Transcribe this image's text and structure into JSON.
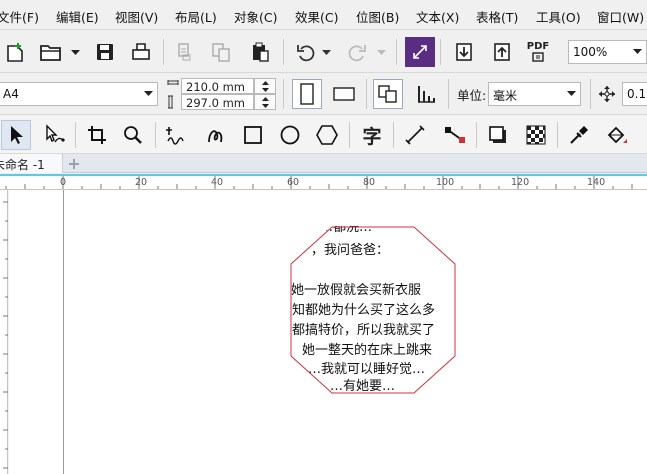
{
  "menu": [
    "文件(F)",
    "编辑(E)",
    "视图(V)",
    "布局(L)",
    "对象(C)",
    "效果(C)",
    "位图(B)",
    "文本(X)",
    "表格(T)",
    "工具(O)",
    "窗口(W)"
  ],
  "toolbar": {
    "pdf_label": "PDF",
    "zoom_value": "100%"
  },
  "property_bar": {
    "page_size": "A4",
    "width": "210.0 mm",
    "height": "297.0 mm",
    "units_label": "单位:",
    "units_value": "毫米",
    "nudge_value": "0.1"
  },
  "tools": {
    "text_tool_glyph": "字"
  },
  "tab": {
    "document_name": "未命名 -1"
  },
  "ruler": {
    "marks": [
      "0",
      "20",
      "40",
      "60",
      "80",
      "100",
      "120",
      "140"
    ]
  },
  "canvas": {
    "text_lines": [
      "…都洗…",
      "，我问爸爸：",
      "",
      "她一放假就会买新衣服",
      "知都她为什么买了这么多",
      "都搞特价，所以我就买了",
      "她一整天的在床上跳来",
      "…我就可以睡好觉…",
      "…有她要…"
    ]
  },
  "colors": {
    "hex_outline": "#d0323c",
    "ruler_accent": "#5ec9e6",
    "effects_icon_bg": "#5a2d82"
  }
}
